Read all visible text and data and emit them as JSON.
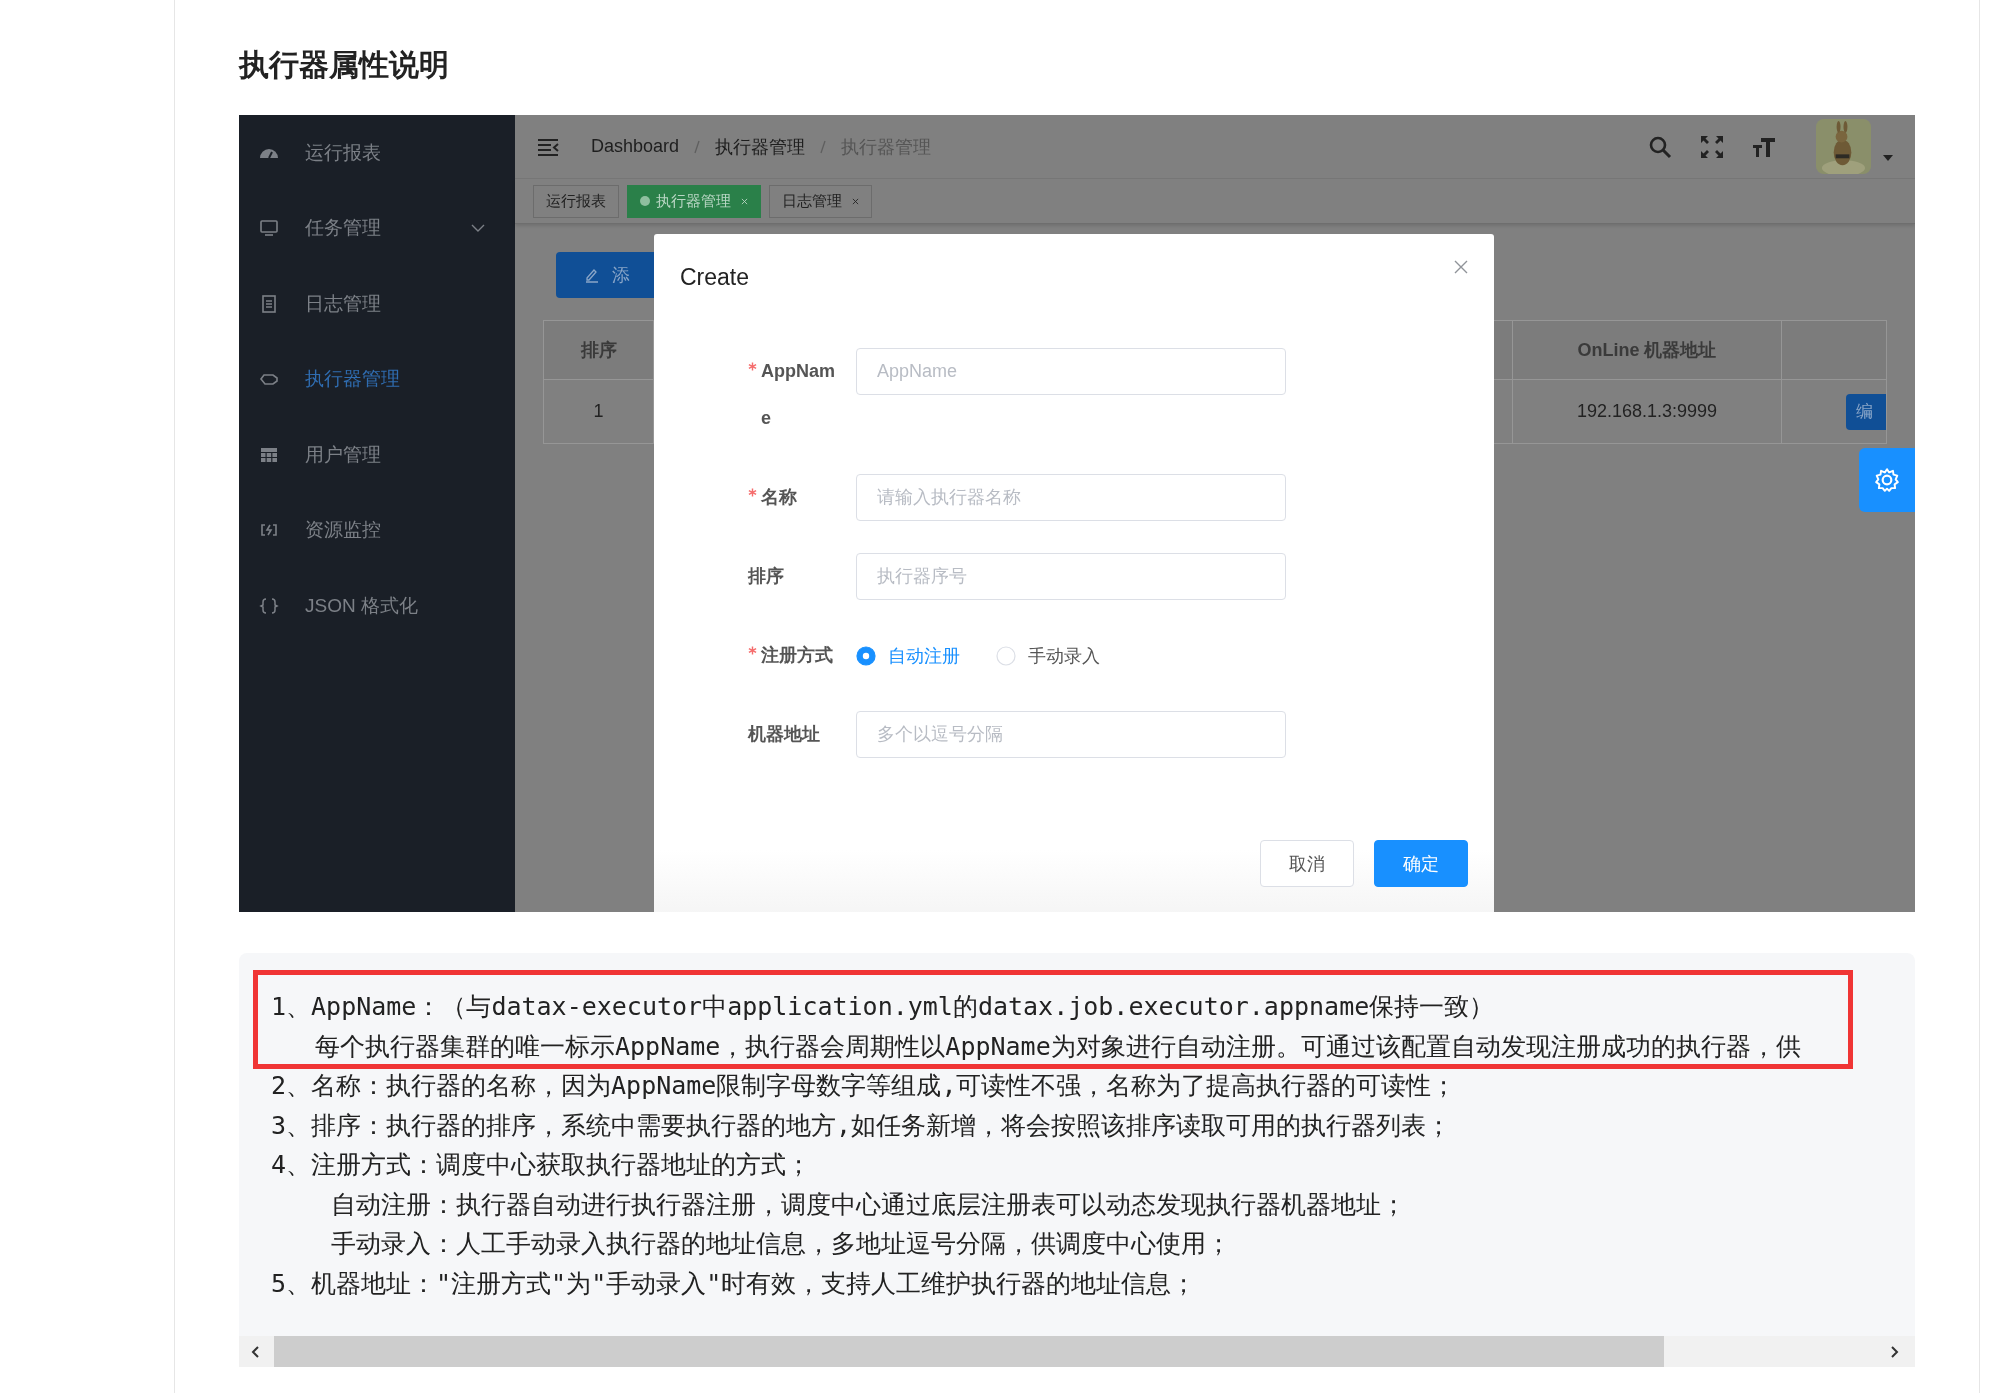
{
  "page": {
    "title": "执行器属性说明"
  },
  "app": {
    "sidebar": [
      {
        "label": "运行报表",
        "selected": false,
        "has_submenu": false
      },
      {
        "label": "任务管理",
        "selected": false,
        "has_submenu": true
      },
      {
        "label": "日志管理",
        "selected": false,
        "has_submenu": false
      },
      {
        "label": "执行器管理",
        "selected": true,
        "has_submenu": false
      },
      {
        "label": "用户管理",
        "selected": false,
        "has_submenu": false
      },
      {
        "label": "资源监控",
        "selected": false,
        "has_submenu": false
      },
      {
        "label": "JSON 格式化",
        "selected": false,
        "has_submenu": false
      }
    ],
    "breadcrumb": [
      {
        "label": "Dashboard",
        "current": false
      },
      {
        "label": "执行器管理",
        "current": false
      },
      {
        "label": "执行器管理",
        "current": true
      }
    ],
    "tabs": [
      {
        "label": "运行报表",
        "selected": false,
        "closable": false
      },
      {
        "label": "执行器管理",
        "selected": true,
        "closable": true
      },
      {
        "label": "日志管理",
        "selected": false,
        "closable": true
      }
    ],
    "add_button": {
      "label": "添"
    },
    "table": {
      "columns": [
        "排序",
        "OnLine 机器地址"
      ],
      "rows": [
        {
          "cells": [
            "1",
            "192.168.1.3:9999"
          ],
          "action": "编"
        }
      ]
    },
    "dialog": {
      "title": "Create",
      "fields": [
        {
          "label": "AppName",
          "required": true,
          "kind": "input",
          "placeholder": "AppName"
        },
        {
          "label": "名称",
          "required": true,
          "kind": "input",
          "placeholder": "请输入执行器名称"
        },
        {
          "label": "排序",
          "required": false,
          "kind": "input",
          "placeholder": "执行器序号"
        },
        {
          "label": "注册方式",
          "required": true,
          "kind": "radio",
          "options": [
            {
              "label": "自动注册",
              "selected": true
            },
            {
              "label": "手动录入",
              "selected": false
            }
          ]
        },
        {
          "label": "机器地址",
          "required": false,
          "kind": "input",
          "placeholder": "多个以逗号分隔"
        }
      ],
      "buttons": [
        {
          "label": "取消",
          "kind": "default"
        },
        {
          "label": "确定",
          "kind": "primary"
        }
      ]
    }
  },
  "notes": {
    "lines": [
      {
        "text": "1、AppName：（与datax-executor中application.yml的datax.job.executor.appname保持一致）",
        "kind": "item"
      },
      {
        "text": "每个执行器集群的唯一标示AppName，执行器会周期性以AppName为对象进行自动注册。可通过该配置自动发现注册成功的执行器，供",
        "kind": "continuation"
      },
      {
        "text": "2、名称：执行器的名称，因为AppName限制字母数字等组成,可读性不强，名称为了提高执行器的可读性；",
        "kind": "item"
      },
      {
        "text": "3、排序：执行器的排序，系统中需要执行器的地方,如任务新增，将会按照该排序读取可用的执行器列表；",
        "kind": "item"
      },
      {
        "text": "4、注册方式：调度中心获取执行器地址的方式；",
        "kind": "item"
      },
      {
        "text": "自动注册：执行器自动进行执行器注册，调度中心通过底层注册表可以动态发现执行器机器地址；",
        "kind": "sub"
      },
      {
        "text": "手动录入：人工手动录入执行器的地址信息，多地址逗号分隔，供调度中心使用；",
        "kind": "sub"
      },
      {
        "text": "5、机器地址：\"注册方式\"为\"手动录入\"时有效，支持人工维护执行器的地址信息；",
        "kind": "item"
      }
    ]
  }
}
